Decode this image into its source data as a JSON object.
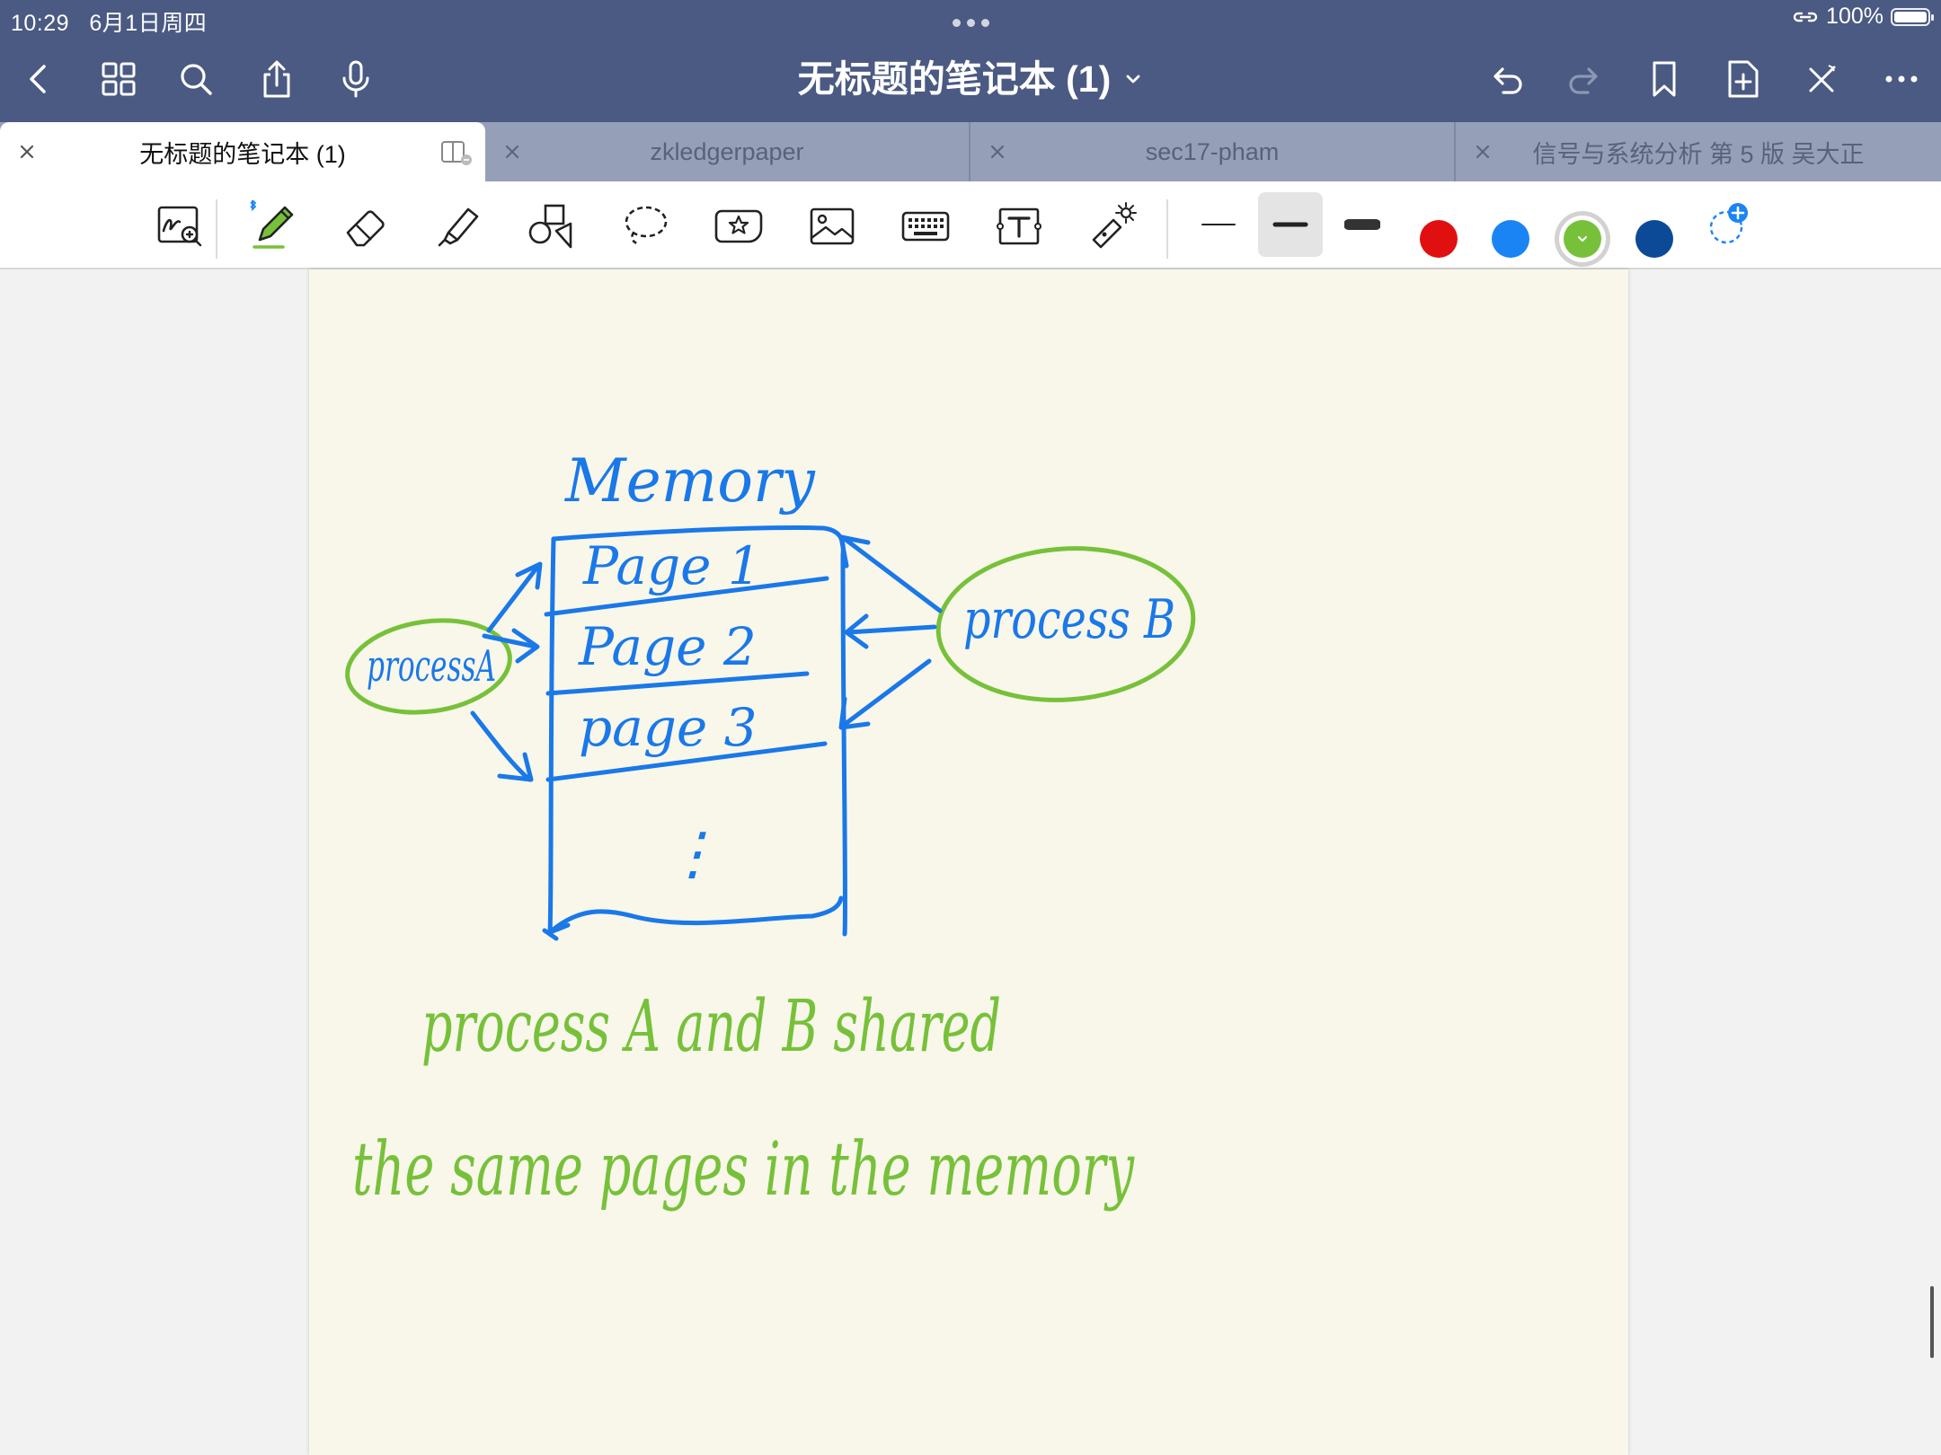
{
  "status_bar": {
    "time": "10:29",
    "date": "6月1日周四",
    "battery": "100%"
  },
  "header": {
    "title": "无标题的笔记本 (1)",
    "icons": [
      "back-chevron-icon",
      "grid-icon",
      "search-icon",
      "share-icon",
      "microphone-icon",
      "undo-icon",
      "redo-icon",
      "bookmark-icon",
      "add-page-icon",
      "close-toolbar-icon",
      "more-icon"
    ]
  },
  "tabs": [
    {
      "label": "无标题的笔记本 (1)",
      "active": true
    },
    {
      "label": "zkledgerpaper",
      "active": false
    },
    {
      "label": "sec17-pham",
      "active": false
    },
    {
      "label": "信号与系统分析 第 5 版 吴大正",
      "active": false
    }
  ],
  "toolbar": {
    "tools": [
      "zoom-window-icon",
      "pen-icon",
      "eraser-icon",
      "highlighter-icon",
      "shapes-icon",
      "lasso-icon",
      "sticker-icon",
      "image-icon",
      "keyboard-icon",
      "text-box-icon",
      "laser-pointer-icon"
    ],
    "strokes": [
      "thin",
      "medium",
      "thick"
    ],
    "selected_stroke": "medium",
    "colors": [
      "#e01010",
      "#1a84f5",
      "#77c13a",
      "#0c4a98"
    ],
    "selected_color": "#77c13a"
  },
  "note": {
    "blue_ink": "#1a78e8",
    "green_ink": "#77c13a",
    "memory_label": "Memory",
    "page_1": "Page 1",
    "page_2": "Page 2",
    "page_3": "page 3",
    "ellipsis": "⋮",
    "process_a": "processA",
    "process_b": "process B",
    "line_1": "process A and B shared",
    "line_2": "the same pages in the memory"
  }
}
